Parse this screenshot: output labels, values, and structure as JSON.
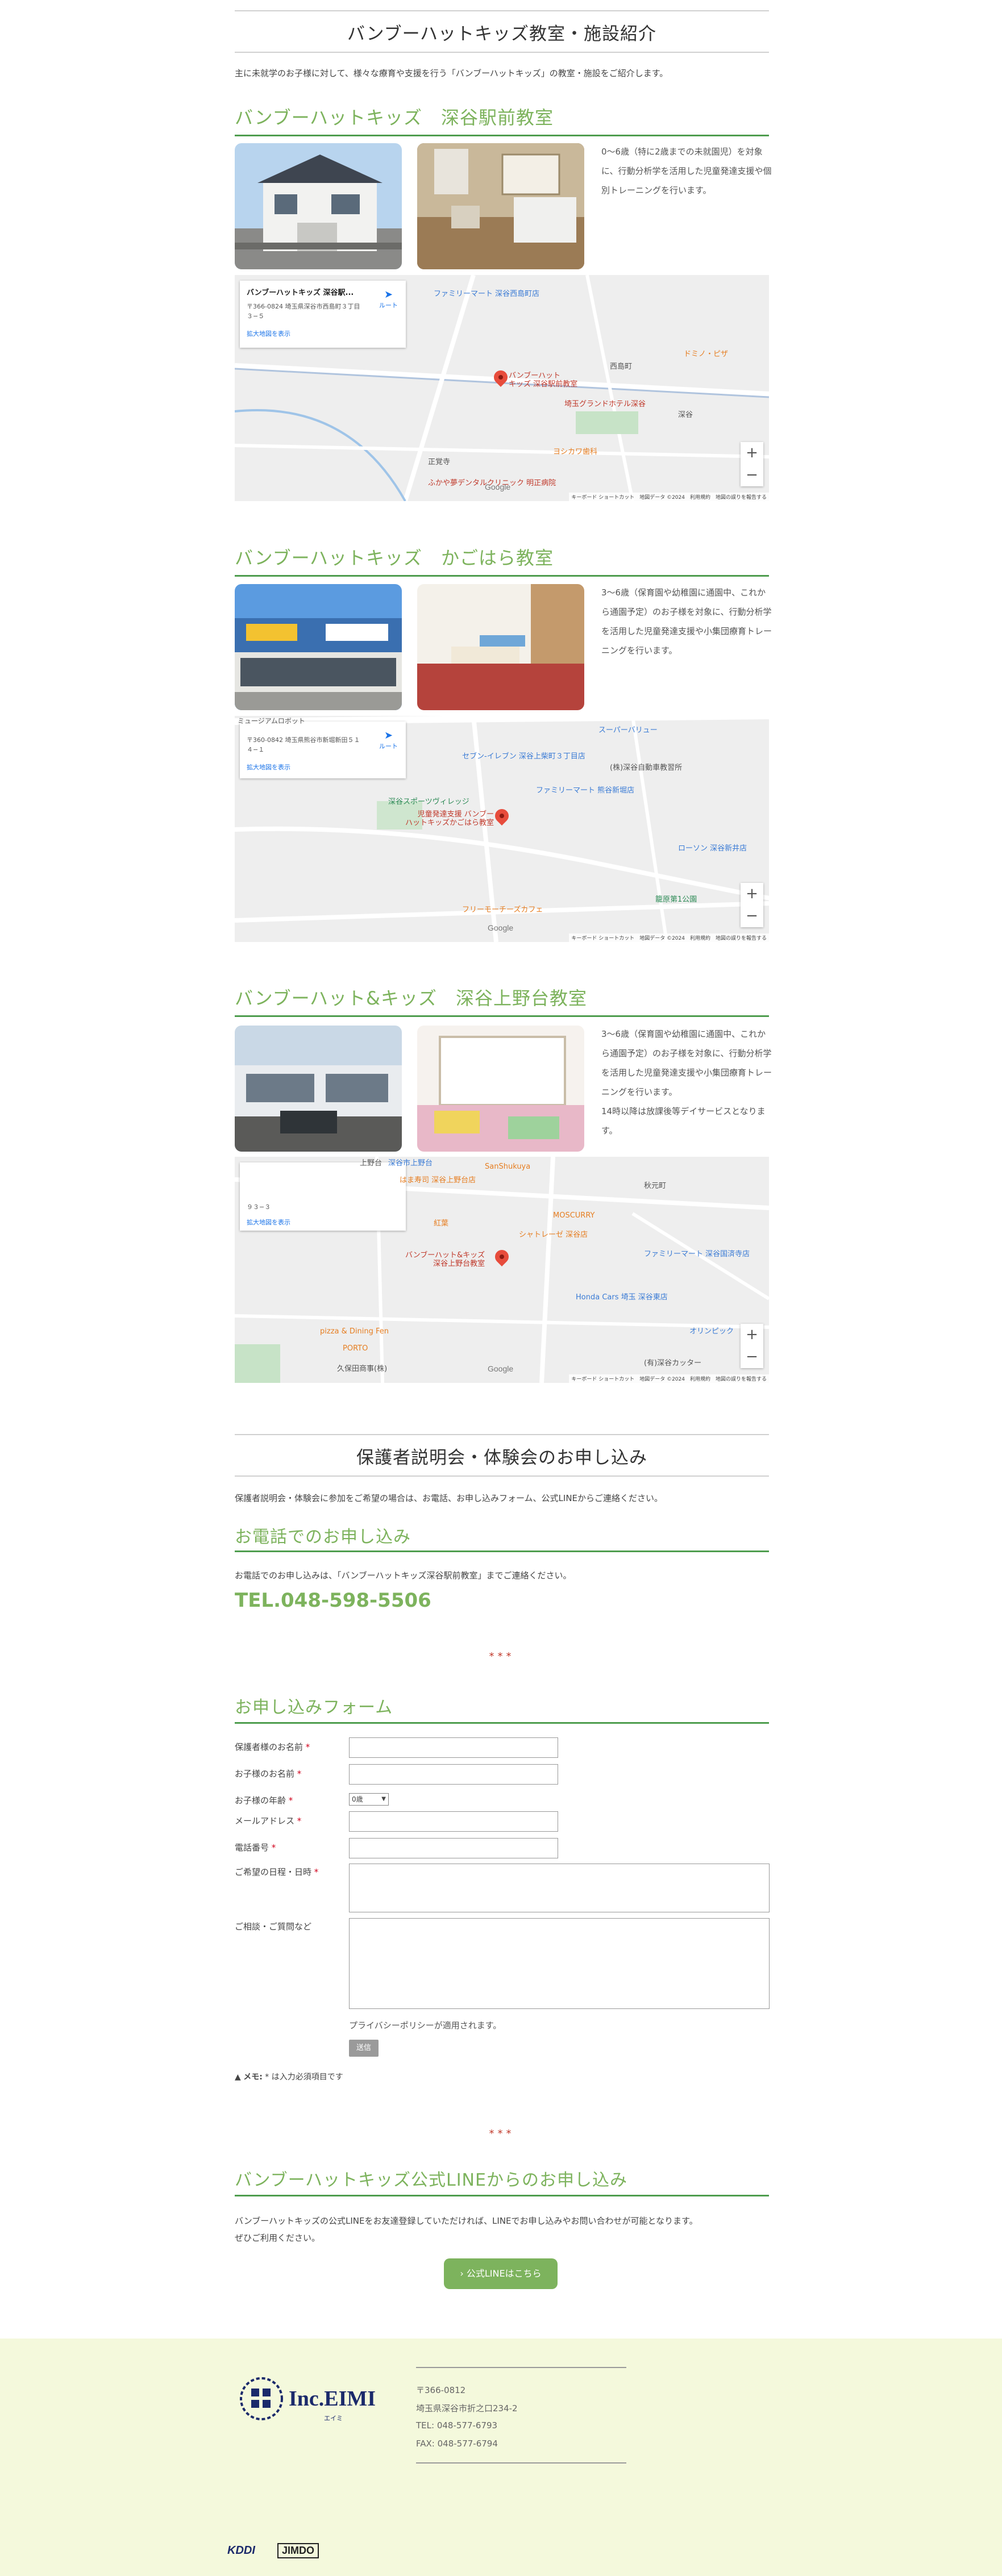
{
  "page": {
    "title": "バンブーハットキッズ教室・施設紹介",
    "lead": "主に未就学のお子様に対して、様々な療育や支援を行う「バンブーハットキッズ」の教室・施設をご紹介します。"
  },
  "classrooms": [
    {
      "heading": "バンブーハットキッズ　深谷駅前教室",
      "description": "0～6歳（特に2歳までの未就園児）を対象に、行動分析学を活用した児童発達支援や個別トレーニングを行います。",
      "map": {
        "name": "バンブーハットキッズ 深谷駅...",
        "address": "〒366-0824 埼玉県深谷市西島町３丁目３−５",
        "link": "拡大地図を表示",
        "route": "ルート",
        "pin_label": "バンブーハット\nキッズ 深谷駅前教室",
        "labels": [
          "ファミリーマート 深谷西島町店",
          "ドミノ・ピザ",
          "西島町",
          "埼玉グランドホテル深谷",
          "深谷",
          "ヨシカワ歯科",
          "正覚寺",
          "ふかや夢デンタルクリニック 明正病院"
        ],
        "footer": "キーボード ショートカット　地図データ ©2024　利用規約　地図の誤りを報告する"
      }
    },
    {
      "heading": "バンブーハットキッズ　かごはら教室",
      "description": "3～6歳（保育園や幼稚園に通園中、これから通園予定）のお子様を対象に、行動分析学を活用した児童発達支援や小集団療育トレーニングを行います。",
      "map": {
        "name": "",
        "address": "〒360-0842 埼玉県熊谷市新堀新田５１４−１",
        "link": "拡大地図を表示",
        "route": "ルート",
        "pin_label": "児童発達支援 バンブー\nハットキッズかごはら教室",
        "labels": [
          "ミュージアムロボット",
          "セブン-イレブン 深谷上柴町３丁目店",
          "スーパーバリュー",
          "(株)深谷自動車教習所",
          "深谷スポーツヴィレッジ",
          "ファミリーマート 熊谷新堀店",
          "ローソン 深谷新井店",
          "フリーモーチーズカフェ",
          "籠原第1公園",
          "Google"
        ],
        "footer": "キーボード ショートカット　地図データ ©2024　利用規約　地図の誤りを報告する"
      }
    },
    {
      "heading": "バンブーハット&キッズ　深谷上野台教室",
      "description": "3～6歳（保育園や幼稚園に通園中、これから通園予定）のお子様を対象に、行動分析学を活用した児童発達支援や小集団療育トレーニングを行います。\n14時以降は放課後等デイサービスとなります。",
      "map": {
        "name": "",
        "address": "９３−３",
        "link": "拡大地図を表示",
        "route": "",
        "pin_label": "バンブーハット&キッズ\n深谷上野台教室",
        "labels": [
          "上野台",
          "深谷市上野台",
          "はま寿司 深谷上野台店",
          "SanShukuya",
          "MOSCURRY",
          "紅葉",
          "シャトレーゼ 深谷店",
          "ファミリーマート 深谷国済寺店",
          "秋元町",
          "Honda Cars 埼玉 深谷東店",
          "オリンピック",
          "pizza & Dining Fen",
          "PORTO",
          "久保田商事(株)",
          "(有)深谷カッター"
        ],
        "footer": "キーボード ショートカット　地図データ ©2024　利用規約　地図の誤りを報告する"
      }
    }
  ],
  "briefing": {
    "title": "保護者説明会・体験会のお申し込み",
    "lead": "保護者説明会・体験会に参加をご希望の場合は、お電話、お申し込みフォーム、公式LINEからご連絡ください。"
  },
  "phone": {
    "heading": "お電話でのお申し込み",
    "note": "お電話でのお申し込みは、「バンブーハットキッズ深谷駅前教室」までご連絡ください。",
    "number": "TEL.048-598-5506"
  },
  "separator": "***",
  "form": {
    "heading": "お申し込みフォーム",
    "fields": {
      "parent_name": "保護者様のお名前",
      "child_name": "お子様のお名前",
      "child_age": "お子様の年齢",
      "email": "メールアドレス",
      "phone": "電話番号",
      "date": "ご希望の日程・日時",
      "question": "ご相談・ご質問など"
    },
    "required_mark": "*",
    "age_value": "0歳",
    "privacy": "プライバシーポリシーが適用されます。",
    "submit": "送信",
    "memo_label": "メモ:",
    "memo_text": "* は入力必須項目です"
  },
  "line": {
    "heading": "バンブーハットキッズ公式LINEからのお申し込み",
    "text1": "バンブーハットキッズの公式LINEをお友達登録していただければ、LINEでお申し込みやお問い合わせが可能となります。",
    "text2": "ぜひご利用ください。",
    "button": "› 公式LINEはこちら"
  },
  "footer": {
    "logo_text": "Inc.EIMI",
    "logo_sub": "エイミ",
    "zip": "〒366-0812",
    "address": "埼玉県深谷市折之口234-2",
    "tel": "TEL: 048-577-6793",
    "fax": "FAX: 048-577-6794",
    "badges": [
      "KDDI",
      "JIMDO"
    ]
  },
  "colors": {
    "accent_green": "#7db35d",
    "line_green": "#4e9d4e",
    "required_red": "#d0021b",
    "footer_bg": "#f4f9dc"
  }
}
